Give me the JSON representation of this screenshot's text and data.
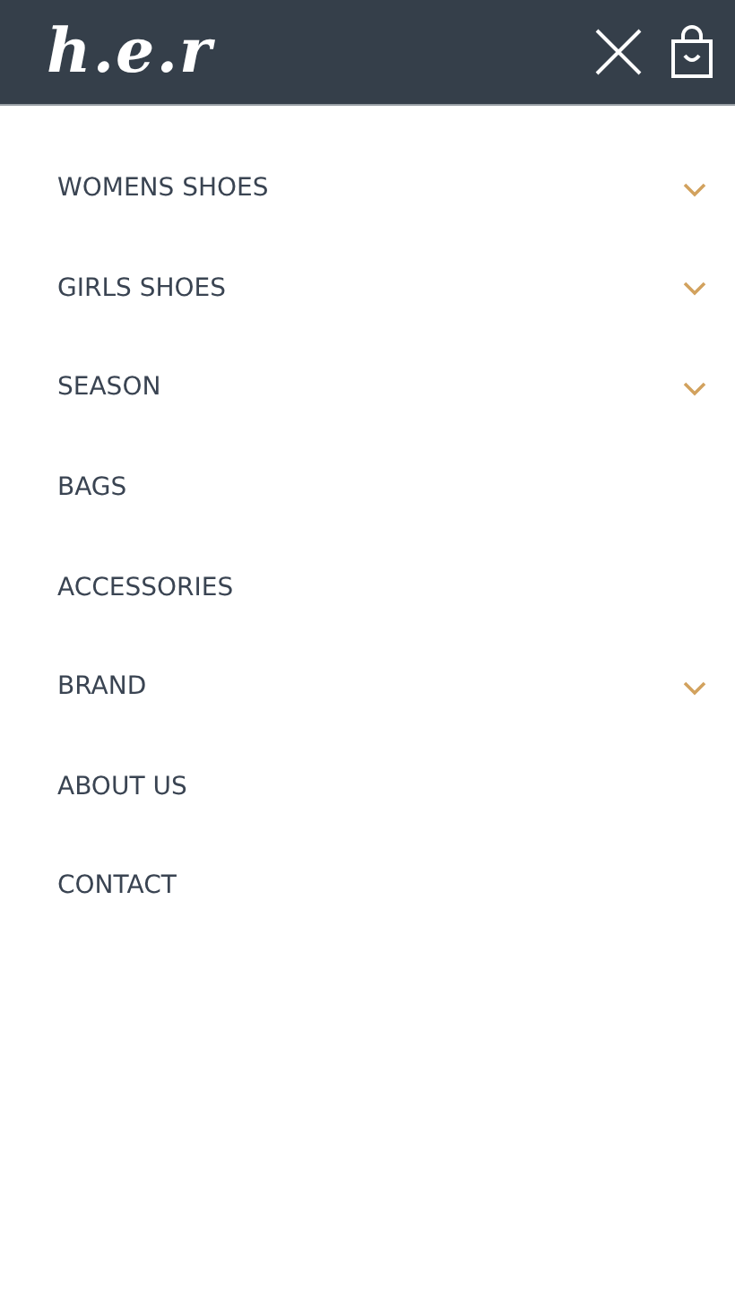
{
  "header": {
    "logo": "h.e.r"
  },
  "menu": [
    {
      "label": "WOMENS SHOES",
      "expandable": true
    },
    {
      "label": "GIRLS SHOES",
      "expandable": true
    },
    {
      "label": "SEASON",
      "expandable": true
    },
    {
      "label": "BAGS",
      "expandable": false
    },
    {
      "label": "ACCESSORIES",
      "expandable": false
    },
    {
      "label": "BRAND",
      "expandable": true
    },
    {
      "label": "ABOUT US",
      "expandable": false
    },
    {
      "label": "CONTACT",
      "expandable": false
    }
  ]
}
